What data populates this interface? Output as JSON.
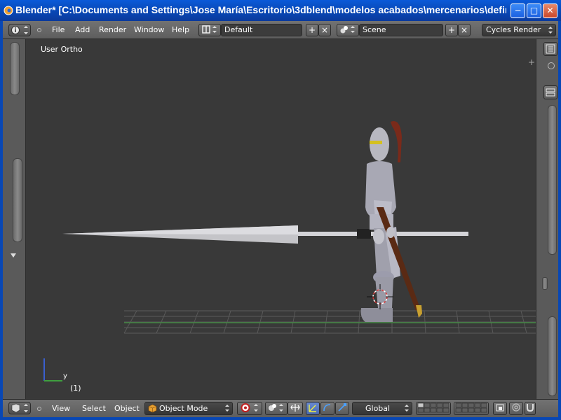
{
  "window": {
    "title": "Blender* [C:\\Documents and Settings\\Jose María\\Escritorio\\3dblend\\modelos acabados\\mercenarios\\definitivo...",
    "minimize_glyph": "−",
    "maximize_glyph": "□",
    "close_glyph": "✕"
  },
  "topbar": {
    "menus": [
      "File",
      "Add",
      "Render",
      "Window",
      "Help"
    ],
    "screen_layout": "Default",
    "scene": "Scene",
    "render_engine": "Cycles Render"
  },
  "viewport": {
    "view_label": "User Ortho",
    "frame_label": "(1)",
    "axis_y_label": "y"
  },
  "bottombar": {
    "menus": [
      "View",
      "Select",
      "Object"
    ],
    "mode": "Object Mode",
    "transform_orientation": "Global"
  },
  "colors": {
    "title_blue": "#0847b5",
    "viewport_bg": "#393939",
    "header_gray": "#6a6a6a"
  }
}
